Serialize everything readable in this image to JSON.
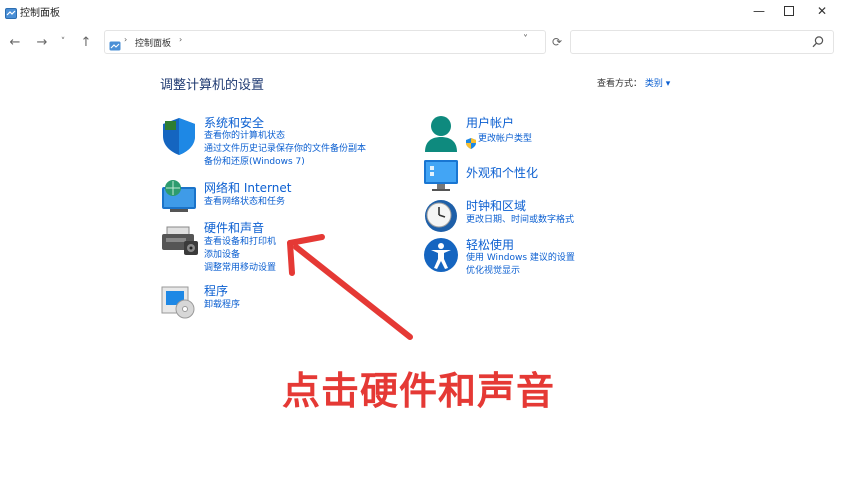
{
  "window": {
    "title": "控制面板",
    "minimize_icon": "minimize-icon",
    "maximize_icon": "maximize-icon",
    "close_icon": "close-icon"
  },
  "address_bar": {
    "breadcrumb": "控制面板",
    "search_placeholder": ""
  },
  "main": {
    "heading": "调整计算机的设置",
    "view_by_label": "查看方式：",
    "view_by_value": "类别",
    "left_categories": [
      {
        "title": "系统和安全",
        "icon": "shield-icon",
        "links": [
          "查看你的计算机状态",
          "通过文件历史记录保存你的文件备份副本",
          "备份和还原(Windows 7)"
        ]
      },
      {
        "title": "网络和 Internet",
        "icon": "network-icon",
        "links": [
          "查看网络状态和任务"
        ]
      },
      {
        "title": "硬件和声音",
        "icon": "printer-icon",
        "links": [
          "查看设备和打印机",
          "添加设备",
          "调整常用移动设置"
        ]
      },
      {
        "title": "程序",
        "icon": "programs-icon",
        "links": [
          "卸载程序"
        ]
      }
    ],
    "right_categories": [
      {
        "title": "用户帐户",
        "icon": "user-icon",
        "links": [
          "更改帐户类型"
        ]
      },
      {
        "title": "外观和个性化",
        "icon": "monitor-icon",
        "links": []
      },
      {
        "title": "时钟和区域",
        "icon": "clock-icon",
        "links": [
          "更改日期、时间或数字格式"
        ]
      },
      {
        "title": "轻松使用",
        "icon": "accessibility-icon",
        "links": [
          "使用 Windows 建议的设置",
          "优化视觉显示"
        ]
      }
    ]
  },
  "annotation": {
    "text": "点击硬件和声音",
    "color": "#e53935"
  },
  "colors": {
    "link": "#0b5fd1",
    "heading": "#1f3a72",
    "shield": "#1565c0",
    "user": "#0e8a7e"
  }
}
